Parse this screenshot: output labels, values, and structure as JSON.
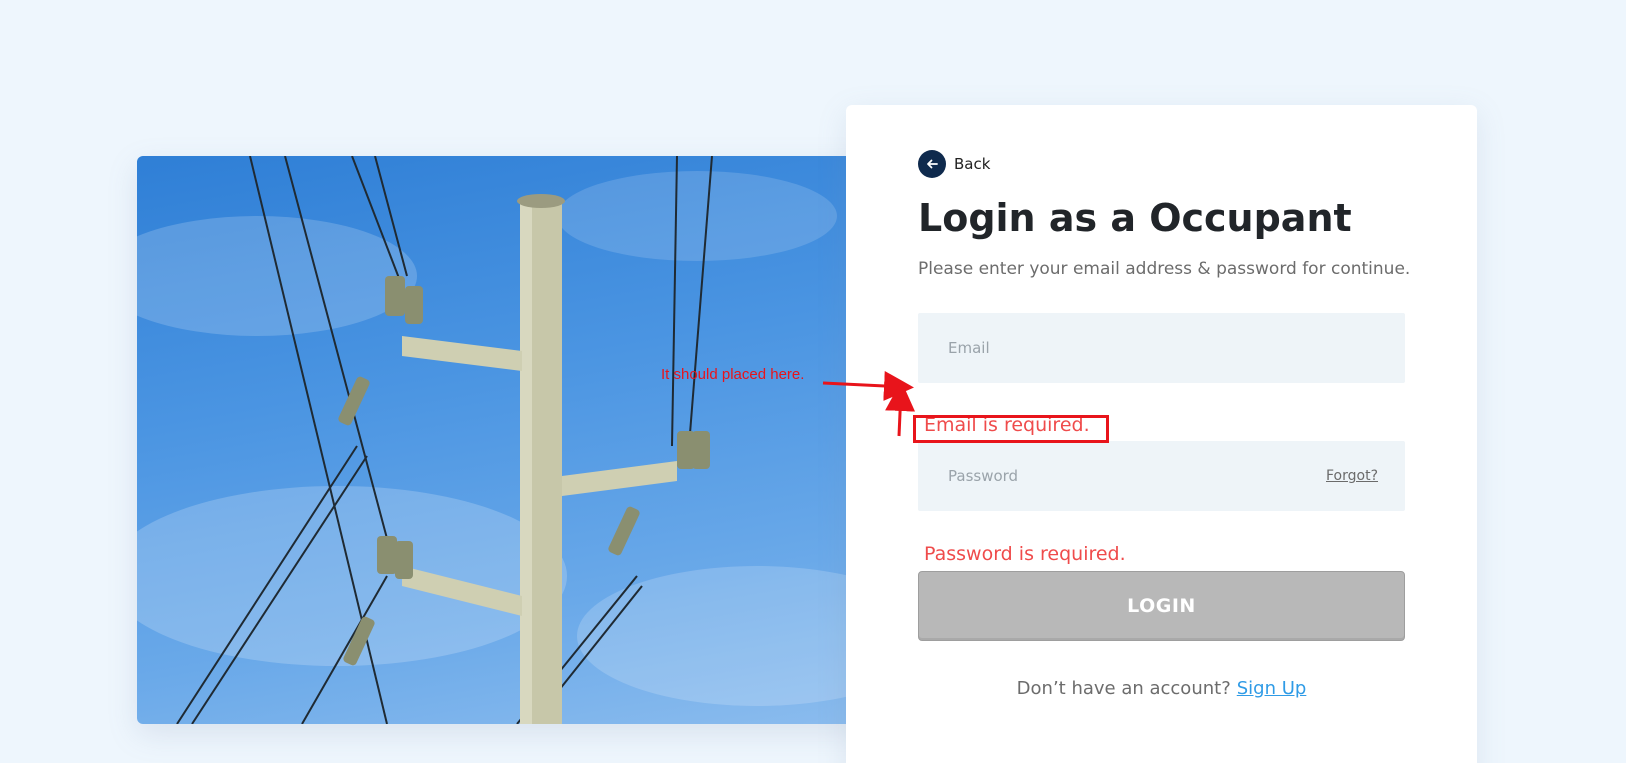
{
  "back": {
    "label": "Back",
    "icon": "arrow-left-icon"
  },
  "login": {
    "title": "Login as a Occupant",
    "subtitle": "Please enter your email address & password for continue.",
    "email_placeholder": "Email",
    "email_error": "Email is required.",
    "password_placeholder": "Password",
    "forgot_label": "Forgot?",
    "password_error": "Password is required.",
    "login_label": "LOGIN",
    "signup_prompt": "Don’t have an account?",
    "signup_label": "Sign Up"
  },
  "annotation": {
    "note": "It should placed here."
  },
  "colors": {
    "background": "#eef6fd",
    "error": "#ef4b4b",
    "link": "#2f9be6",
    "button_disabled": "#b8b8b8",
    "annotation": "#e8141b",
    "back_circle": "#0f2a4d"
  }
}
